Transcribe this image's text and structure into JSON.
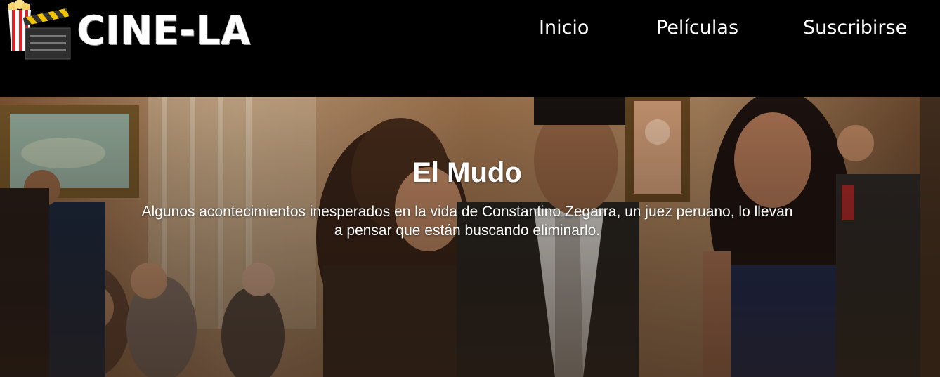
{
  "brand": {
    "name": "CINE-LA",
    "logo_icon": "popcorn-clapperboard-icon"
  },
  "nav": {
    "items": [
      {
        "label": "Inicio"
      },
      {
        "label": "Películas"
      },
      {
        "label": "Suscribirse"
      }
    ]
  },
  "hero": {
    "title": "El Mudo",
    "description": "Algunos acontecimientos inesperados en la vida de Constantino Zegarra, un juez peruano, lo llevan a pensar que están buscando eliminarlo.",
    "image": "movie-still-photo"
  },
  "colors": {
    "header_bg": "#000000",
    "text": "#ffffff",
    "popcorn_red": "#d8232a",
    "clapper_yellow": "#f2c300"
  }
}
